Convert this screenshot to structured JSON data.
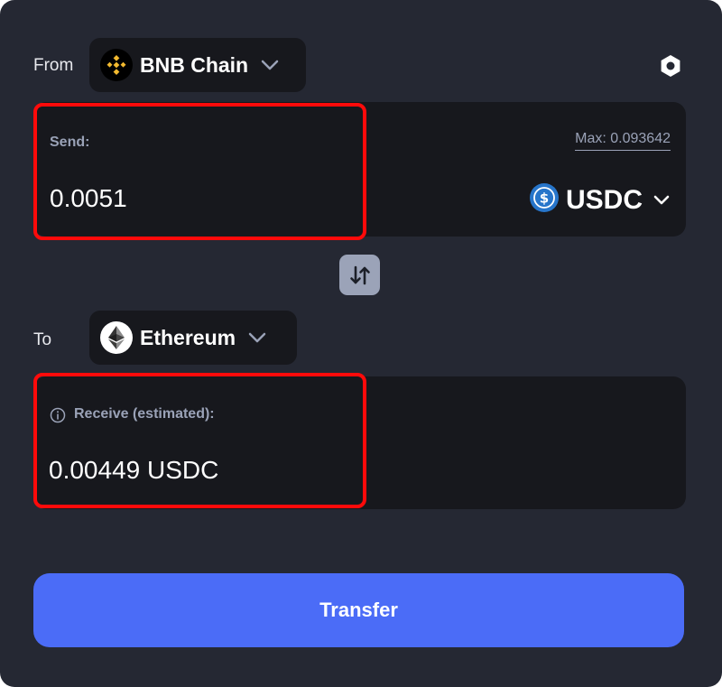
{
  "from": {
    "label": "From",
    "chain": {
      "name": "BNB Chain",
      "icon": "bnb-chain-icon",
      "color": "#F3BA2F"
    }
  },
  "send": {
    "label": "Send:",
    "value": "0.0051",
    "max_label": "Max: 0.093642",
    "token": {
      "symbol": "USDC",
      "icon": "usdc-icon",
      "color": "#2775CA"
    }
  },
  "to": {
    "label": "To",
    "chain": {
      "name": "Ethereum",
      "icon": "ethereum-icon"
    }
  },
  "receive": {
    "label": "Receive (estimated):",
    "value": "0.00449 USDC"
  },
  "transfer": {
    "label": "Transfer"
  },
  "colors": {
    "background": "#252833",
    "card": "#17181D",
    "accent": "#4B6CF7",
    "highlight": "#FF0A0A",
    "muted_text": "#9AA2B7"
  }
}
